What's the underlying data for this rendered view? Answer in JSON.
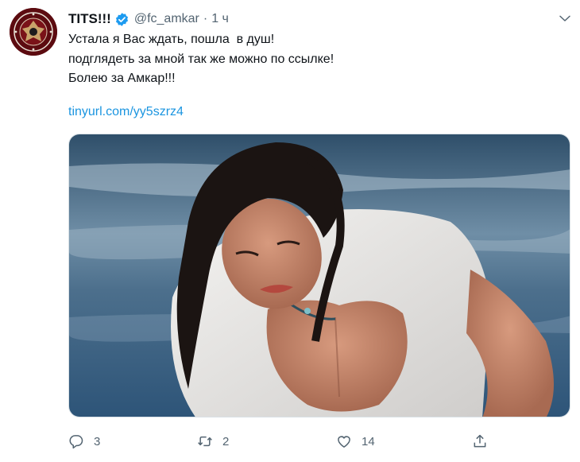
{
  "tweet": {
    "display_name": "TITS!!!",
    "handle": "@fc_amkar",
    "separator": "·",
    "time": "1 ч",
    "text_lines": [
      "Устала я Вас ждать, пошла  в душ!",
      "подглядеть за мной так же можно по ссылке!",
      "Болею за Амкар!!!"
    ],
    "link": "tinyurl.com/yy5szrz4"
  },
  "actions": {
    "reply_count": "3",
    "retweet_count": "2",
    "like_count": "14"
  },
  "icons": {
    "avatar": "club-crest-avatar",
    "verified": "verified-badge-icon",
    "more": "chevron-down-icon",
    "reply": "reply-icon",
    "retweet": "retweet-icon",
    "like": "heart-icon",
    "share": "share-icon"
  },
  "colors": {
    "link": "#1b95e0",
    "verified": "#1d9bf0",
    "muted": "#536471",
    "text": "#0f1419"
  }
}
